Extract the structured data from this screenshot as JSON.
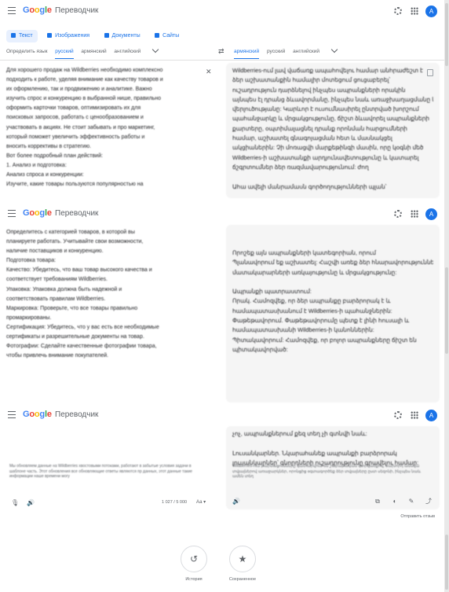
{
  "app": {
    "logo": [
      "G",
      "o",
      "o",
      "g",
      "l",
      "e"
    ],
    "name": "Переводчик",
    "avatar": "A"
  },
  "modes": [
    "Текст",
    "Изображения",
    "Документы",
    "Сайты"
  ],
  "source_langs": [
    "Определить язык",
    "русский",
    "армянский",
    "английский"
  ],
  "target_langs": [
    "армянский",
    "русский",
    "английский"
  ],
  "source_lines": [
    "Для хорошего продаж на Wildberries необходимо комплексно",
    "подходить к работе, уделяя внимание как качеству товаров и",
    "их оформлению, так и продвижению и аналитике. Важно",
    "изучить спрос и конкуренцию в выбранной нише, правильно",
    "оформить карточки товаров, оптимизировать их для",
    "поисковых запросов, работать с ценообразованием и",
    "участвовать в акциях. Не стоит забывать и про маркетинг,",
    "который поможет увеличить эффективность работы и",
    "вносить коррективы в стратегию.",
    "Вот более подробный план действий:",
    "1. Анализ и подготовка:",
    "Анализ спроса и конкуренции:",
    "Изучите, какие товары пользуются популярностью на"
  ],
  "target_lines": [
    "Wildberries-ում լավ վաճառք ապահովելու համար անհրաժեշտ է",
    "ձեր աշխատանքին համալիր մոտեցում ցուցաբերել՝",
    "ուշադրություն դարձնելով ինչպես ապրանքների որակին",
    "այնպես էլ դրանց ձևավորմանը, ինչպես նաև առաջխաղացմանը և",
    "վերլուծությանը: Կարևոր է ուսումնասիրել ընտրված խորշում",
    "պահանջարկը և մրցակցությունը, ճիշտ ձևավորել ապրանքների",
    "քարտերը, օպտիմալացնել դրանք որոնման հարցումների",
    "համար, աշխատել գնագոյացման հետ և մասնակցել",
    "ակցիաներին: Չի մոռացվի մարքեթինգի մասին, որը կօգնի մեծ",
    "Wildberries-ի աշխատանքի արդյունավետությունը և կատարել",
    "ճշգրտումներ ձեր ռազմավարությունում: ժող",
    "",
    "Ահա ավելի մանրամասն գործողությունների պլան՝"
  ],
  "source_lines_2": [
    "Определитесь с категорией товаров, в которой вы",
    "планируете работать. Учитывайте свои возможности,",
    "наличие поставщиков и конкуренцию.",
    "Подготовка товара:",
    "Качество: Убедитесь, что ваш товар высокого качества и",
    "соответствует требованиям Wildberries.",
    "Упаковка: Упаковка должна быть надежной и",
    "соответствовать правилам Wildberries.",
    "Маркировка: Проверьте, что все товары правильно",
    "промаркированы.",
    "Сертификация: Убедитесь, что у вас есть все необходимые",
    "сертификаты и разрешительные документы на товар.",
    "Фотографии: Сделайте качественные фотографии товара,",
    "чтобы привлечь внимание покупателей."
  ],
  "target_lines_2": [
    "Որոշեք այն ապրանքների կատեգորիան, որում",
    "Պլանավորում եք աշխատել: Հաշվի առեք ձեր հնարավորությունները,",
    "մատակարարների առկայությունը և մրցակցությունը:",
    "",
    "Ապրանքի պատրաստում:",
    "Որակ. Համոզվեք, որ ձեր ապրանքը բարձրորակ է և",
    "համապատասխանում է Wildberries-ի պահանջներին:",
    "Փաթեթավորում. Փաթեթավորումը պետք է լինի հուսալի և",
    "համապատասխանի Wildberries-ի կանոններին:",
    "Պիտակավորում: Համոզվեք, որ բոլոր ապրանքները ճիշտ են",
    "պիտակավորված:"
  ],
  "target_lines_3": [
    "չոչ, ապրանքներում քեզ տեղ չի գտնվի նաև:",
    "",
    "Լուսանկարներ. Նկարահանեք ապրանքի բարձրորակ",
    "լուսանկարներ՝ գնորդների ուշադրությունը գրավելու համար:"
  ],
  "s3_note": "Мы обновляем данные на Wildberries хвостовыми потоками, работают в забытые условия задачи в шаблоне часть. Этот обновления все обновляющие ответы являются пр данных, этот данные такие информации наше времени могу",
  "s3_tgt_note": "Wildberries-ում թարմացումները կատարվում են շաբաթական կտրվածքով, նախորդ ամսվա տվյալներով առաջարկներ, որոնցից օգտագործեք ձեր տվյալները ըստ սեզոնի, ինչպես նաև ամեն տեղ",
  "counter": "1 027 / 5 000",
  "size_label": "Аа",
  "feedback": "Отправить отзыв",
  "bottom": {
    "history": "История",
    "saved": "Сохраненное"
  },
  "icons": {
    "menu": "hamburger-icon",
    "settings": "gear-icon",
    "apps": "apps-grid-icon",
    "swap": "swap-icon",
    "clear": "close-icon",
    "mic": "mic-icon",
    "speaker": "speaker-icon",
    "copy": "copy-icon",
    "history": "history-icon",
    "saved": "star-icon"
  }
}
